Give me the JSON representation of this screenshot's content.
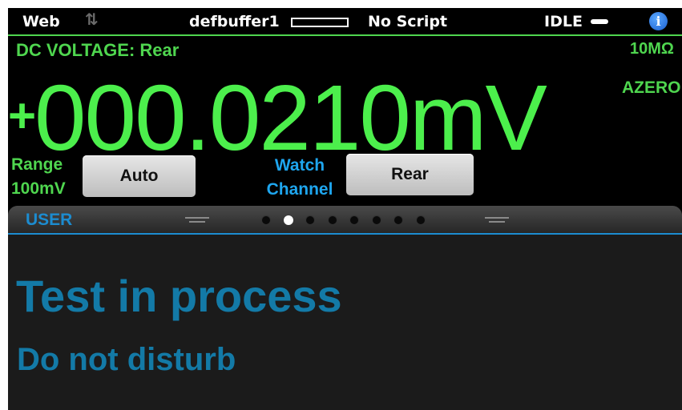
{
  "status_bar": {
    "web_label": "Web",
    "transfer_icon": "up-down-arrows-icon",
    "buffer_name": "defbuffer1",
    "script_label": "No Script",
    "state": "IDLE",
    "trigger_icon": "trigger-bar-icon",
    "info_icon": "i"
  },
  "measurement": {
    "function_label": "DC VOLTAGE: Rear",
    "input_impedance": "10MΩ",
    "autozero": "AZERO",
    "sign": "+",
    "value": "000.0210",
    "unit": "mV"
  },
  "controls": {
    "range_label_1": "Range",
    "range_label_2": "100mV",
    "range_button": "Auto",
    "watch_label_1": "Watch",
    "watch_label_2": "Channel",
    "watch_button": "Rear"
  },
  "panel": {
    "title": "USER",
    "page_count": 8,
    "active_page": 2,
    "line1": "Test in process",
    "line2": "Do not disturb"
  },
  "colors": {
    "measurement_green": "#4cef4c",
    "accent_blue": "#1ea6ef",
    "user_text_blue": "#137aa7"
  }
}
